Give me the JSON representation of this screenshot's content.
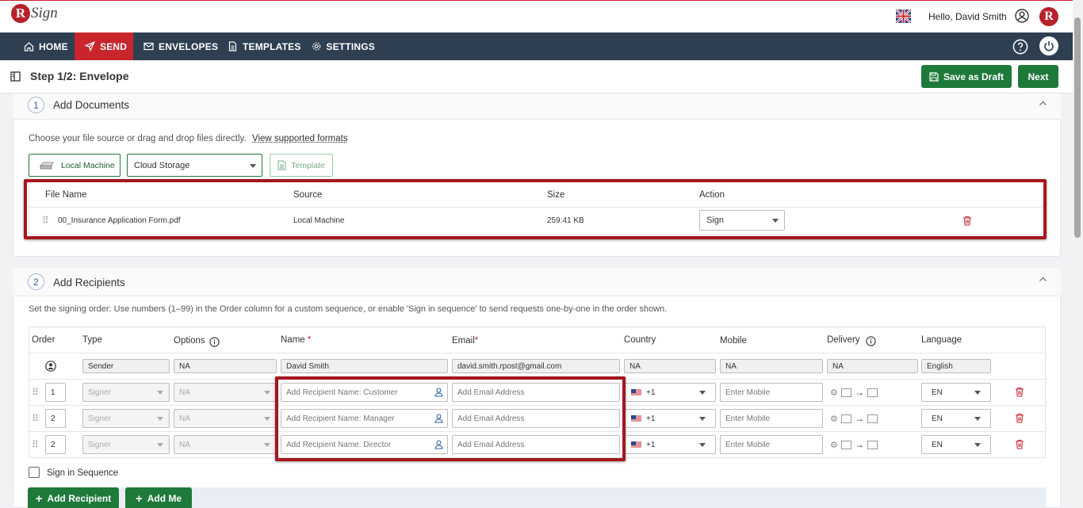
{
  "topbar": {
    "logo_letter": "R",
    "logo_text": "Sign",
    "greeting": "Hello, David Smith",
    "brand_letter": "R",
    "flag_icon": "uk-flag-icon",
    "user_icon": "user-circle-icon"
  },
  "nav": {
    "items": [
      {
        "label": "HOME",
        "icon": "home-icon"
      },
      {
        "label": "SEND",
        "icon": "send-icon",
        "active": true
      },
      {
        "label": "ENVELOPES",
        "icon": "envelope-icon"
      },
      {
        "label": "TEMPLATES",
        "icon": "document-icon"
      },
      {
        "label": "SETTINGS",
        "icon": "gear-icon"
      }
    ],
    "help_icon": "help-icon",
    "power_icon": "power-icon"
  },
  "step": {
    "title": "Step 1/2: Envelope",
    "save_draft_label": "Save as Draft",
    "next_label": "Next"
  },
  "documents": {
    "number": "1",
    "title": "Add Documents",
    "intro": "Choose your file source or drag and drop files directly.",
    "formats_link": "View supported formats",
    "local_machine_label": "Local Machine",
    "cloud_storage_label": "Cloud Storage",
    "template_label": "Template",
    "columns": {
      "file_name": "File Name",
      "source": "Source",
      "size": "Size",
      "action": "Action"
    },
    "rows": [
      {
        "file_name": "00_Insurance Application Form.pdf",
        "source": "Local Machine",
        "size": "259.41 KB",
        "action": "Sign"
      }
    ]
  },
  "recipients": {
    "number": "2",
    "title": "Add Recipients",
    "intro": "Set the signing order: Use numbers (1–99) in the Order column for a custom sequence, or enable 'Sign in sequence' to send requests one-by-one in the order shown.",
    "columns": {
      "order": "Order",
      "type": "Type",
      "options": "Options",
      "name": "Name",
      "email": "Email",
      "country": "Country",
      "mobile": "Mobile",
      "delivery": "Delivery",
      "language": "Language",
      "required_mark": "*"
    },
    "sender": {
      "type": "Sender",
      "options": "NA",
      "name": "David Smith",
      "email": "david.smith.rpost@gmail.com",
      "country": "NA",
      "mobile": "NA",
      "delivery": "NA",
      "language": "English"
    },
    "rows": [
      {
        "order": "1",
        "type": "Signer",
        "options": "NA",
        "name_placeholder": "Add Recipient Name: Customer",
        "email_placeholder": "Add Email Address",
        "country_code": "+1",
        "mobile_placeholder": "Enter Mobile",
        "language": "EN"
      },
      {
        "order": "2",
        "type": "Signer",
        "options": "NA",
        "name_placeholder": "Add Recipient Name: Manager",
        "email_placeholder": "Add Email Address",
        "country_code": "+1",
        "mobile_placeholder": "Enter Mobile",
        "language": "EN"
      },
      {
        "order": "2",
        "type": "Signer",
        "options": "NA",
        "name_placeholder": "Add Recipient Name: Director",
        "email_placeholder": "Add Email Address",
        "country_code": "+1",
        "mobile_placeholder": "Enter Mobile",
        "language": "EN"
      }
    ],
    "sign_in_sequence_label": "Sign in Sequence",
    "add_recipient_label": "Add Recipient",
    "add_me_label": "Add Me"
  },
  "colors": {
    "brand_red": "#c9252c",
    "nav_bg": "#2f3f52",
    "green": "#1e7a3a",
    "highlight_box": "#a4161f"
  }
}
